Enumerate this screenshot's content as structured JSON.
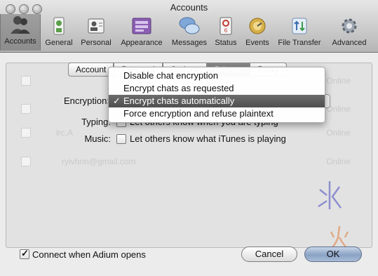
{
  "window": {
    "title": "Accounts"
  },
  "toolbar": {
    "items": [
      {
        "label": "Accounts",
        "icon": "accounts-icon"
      },
      {
        "label": "General",
        "icon": "general-icon"
      },
      {
        "label": "Personal",
        "icon": "personal-icon"
      },
      {
        "label": "Appearance",
        "icon": "appearance-icon"
      },
      {
        "label": "Messages",
        "icon": "messages-icon"
      },
      {
        "label": "Status",
        "icon": "status-icon"
      },
      {
        "label": "Events",
        "icon": "events-icon"
      },
      {
        "label": "File Transfer",
        "icon": "file-transfer-icon"
      },
      {
        "label": "Advanced",
        "icon": "advanced-icon"
      }
    ]
  },
  "accounts_list": {
    "rows": [
      {
        "name": "",
        "status": "Online"
      },
      {
        "name": "",
        "status": "Online"
      },
      {
        "name": "irc.A",
        "status": "Online"
      },
      {
        "name": "ryivhnn@gmail.com",
        "status": "Online"
      }
    ]
  },
  "tabs": [
    "Account",
    "Personal",
    "Options",
    "Privacy",
    "Proxy"
  ],
  "privacy": {
    "encryption_label": "Encryption:",
    "typing_label": "Typing:",
    "typing_text": "Let others know when you are typing",
    "music_label": "Music:",
    "music_text": "Let others know what iTunes is playing"
  },
  "encryption_menu": {
    "options": [
      "Disable chat encryption",
      "Encrypt chats as requested",
      "Encrypt chats automatically",
      "Force encryption and refuse plaintext"
    ],
    "selected_index": 2,
    "check_mark": "✓"
  },
  "footer": {
    "connect_label": "Connect when Adium opens",
    "connect_checked": true,
    "cancel_label": "Cancel",
    "ok_label": "OK"
  },
  "watermark": {
    "line1": "氷",
    "line2": "火"
  }
}
